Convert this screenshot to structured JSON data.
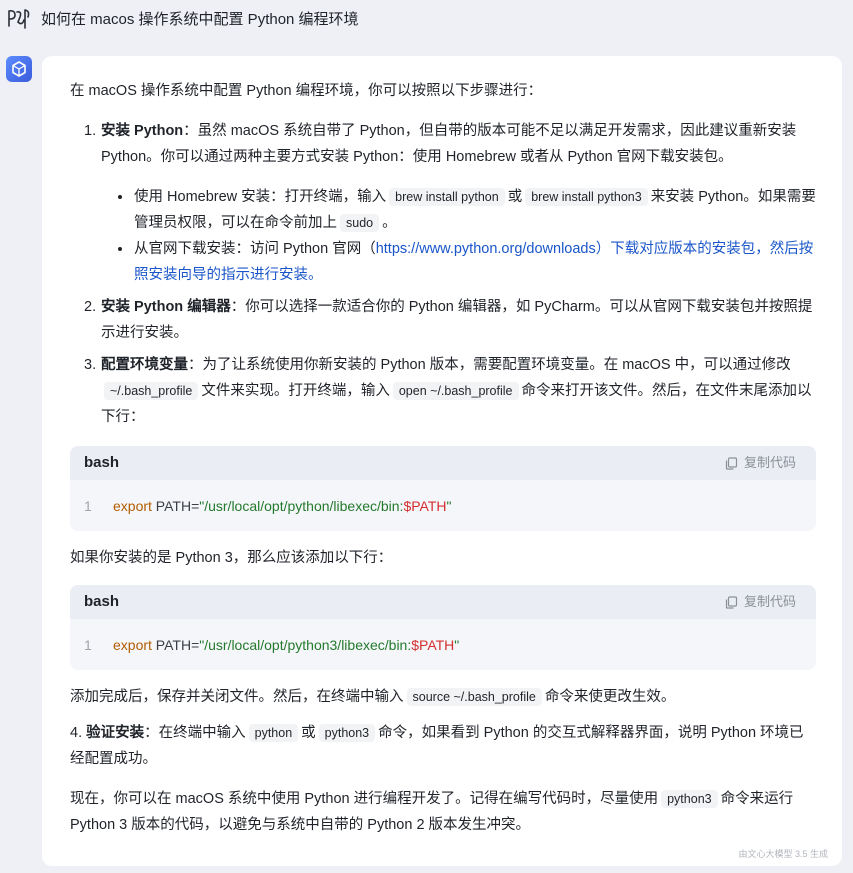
{
  "question": "如何在 macos 操作系统中配置 Python 编程环境",
  "answer": {
    "intro": "在 macOS 操作系统中配置 Python 编程环境，你可以按照以下步骤进行：",
    "step1": {
      "num": "1.",
      "title": "安装 Python",
      "text": "：虽然 macOS 系统自带了 Python，但自带的版本可能不足以满足开发需求，因此建议重新安装 Python。你可以通过两种主要方式安装 Python：使用 Homebrew 或者从 Python 官网下载安装包。",
      "bullet1": {
        "a": "使用 Homebrew 安装：打开终端，输入",
        "code1": "brew install python",
        "b": "或",
        "code2": "brew install python3",
        "c": "来安装 Python。如果需要管理员权限，可以在命令前加上",
        "code3": "sudo",
        "d": "。"
      },
      "bullet2": {
        "a": "从官网下载安装：访问 Python 官网（",
        "link": "https://www.python.org/downloads）下载对应版本的安装包，然后按照安装向导的指示进行安装。"
      }
    },
    "step2": {
      "num": "2.",
      "title": "安装 Python 编辑器",
      "text": "：你可以选择一款适合你的 Python 编辑器，如 PyCharm。可以从官网下载安装包并按照提示进行安装。"
    },
    "step3": {
      "num": "3.",
      "title": "配置环境变量",
      "text_a": "：为了让系统使用你新安装的 Python 版本，需要配置环境变量。在 macOS 中，可以通过修改",
      "code1": "~/.bash_profile",
      "text_b": "文件来实现。打开终端，输入",
      "code2": "open ~/.bash_profile",
      "text_c": "命令来打开该文件。然后，在文件末尾添加以下行："
    },
    "code_block_1": {
      "lang": "bash",
      "copy_label": "复制代码",
      "line_no": "1",
      "kw": "export",
      "var_name": " PATH=",
      "str": "\"/usr/local/opt/python/libexec/bin:",
      "var": "$PATH",
      "str_end": "\""
    },
    "py3_note": "如果你安装的是 Python 3，那么应该添加以下行：",
    "code_block_2": {
      "lang": "bash",
      "copy_label": "复制代码",
      "line_no": "1",
      "kw": "export",
      "var_name": " PATH=",
      "str": "\"/usr/local/opt/python3/libexec/bin:",
      "var": "$PATH",
      "str_end": "\""
    },
    "after_add": {
      "a": "添加完成后，保存并关闭文件。然后，在终端中输入",
      "code": "source ~/.bash_profile",
      "b": "命令来使更改生效。"
    },
    "step4": {
      "num": "4.",
      "title": "验证安装",
      "a": "：在终端中输入",
      "code1": "python",
      "b": "或",
      "code2": "python3",
      "c": "命令，如果看到 Python 的交互式解释器界面，说明 Python 环境已经配置成功。"
    },
    "conclusion": {
      "a": "现在，你可以在 macOS 系统中使用 Python 进行编程开发了。记得在编写代码时，尽量使用",
      "code": "python3",
      "b": "命令来运行 Python 3 版本的代码，以避免与系统中自带的 Python 2 版本发生冲突。"
    }
  },
  "footer": "由文心大模型 3.5 生成",
  "icons": {
    "user": "handwritten-logo-icon",
    "bot": "cube-logo-icon",
    "copy": "copy-icon"
  },
  "colors": {
    "link": "#1a56c9",
    "keyword": "#b35c00",
    "string": "#237a2c",
    "variable": "#d32f2f",
    "bot_avatar": "#4a74f0"
  }
}
